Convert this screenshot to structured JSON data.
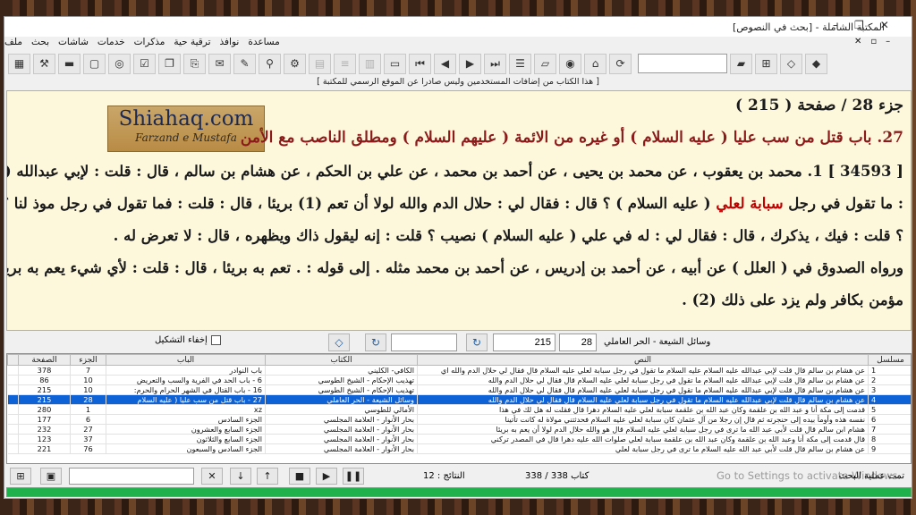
{
  "window": {
    "title": "المكتبة الشاملة - [بحث في النصوص]",
    "controls": [
      "–",
      "❐",
      "✕"
    ]
  },
  "menu": {
    "items": [
      "ملف",
      "بحث",
      "شاشات",
      "خدمات",
      "مذكرات",
      "ترقية حية",
      "نوافذ",
      "مساعدة"
    ],
    "mdi": [
      "–",
      "▫",
      "✕"
    ]
  },
  "toolbar": {
    "search_value": ""
  },
  "notice": "[ هذا الكتاب من إضافات المستخدمين وليس صادرا عن الموقع الرسمي للمكتبة ]",
  "logo": {
    "main": "Shiahaq.com",
    "sub": "Farzand e Mustafa"
  },
  "reader": {
    "page_line": "جزء 28 / صفحة ( 215 )",
    "heading": "27. باب قتل من سب عليا ( عليه السلام ) أو غيره من الائمة ( عليهم السلام ) ومطلق الناصب مع الأمن",
    "line1": "[ 34593 ] 1. محمد بن يعقوب ، عن محمد بن يحيى ، عن أحمد بن محمد ، عن علي بن الحكم ، عن هشام بن سالم ، قال : قلت : لإبي عبدالله ( عليه السلام )",
    "line2_a": ": ما تقول في رجل",
    "line2_red": "سبابة لعلي",
    "line2_b": "( عليه السلام ) ؟ قال : فقال لي : حلال الدم والله لولا أن تعم (1) بريئا ، قال : قلت : فما تقول في رجل موذ لنا ؟ قال : في ماذا",
    "line3": "؟ قلت : فيك ، يذكرك ، قال : فقال لي : له في علي ( عليه السلام ) نصيب ؟ قلت : إنه ليقول ذاك ويظهره ، قال : لا تعرض له .",
    "line4": "ورواه الصدوق في ( العلل ) عن أبيه ، عن أحمد بن إدريس ، عن أحمد بن محمد مثله . إلى قوله : . تعم به بريئا ، قال : قلت : لأي شيء يعم به بريئا ؟ قال : يقتل",
    "line5": "مؤمن بكافر ولم يزد على ذلك (2) ."
  },
  "controls": {
    "hide_diacritics": "إخفاء التشكيل",
    "page_value": "215",
    "part_value": "28",
    "book": "وسائل الشيعة - الحر العاملي",
    "blank1": "",
    "blank2": ""
  },
  "grid": {
    "headers": [
      "",
      "الصفحة",
      "الجزء",
      "الباب",
      "الكتاب",
      "النص",
      "مسلسل"
    ],
    "rows": [
      {
        "page": "378",
        "part": "7",
        "chapter": "باب النوادر",
        "book": "الكافي- الكليني",
        "text": "عن هشام بن سالم قال قلت لإبي عبدالله عليه السلام عليه السلام ما تقول في رجل سبابة لعلي عليه السلام قال فقال لي حلال الدم والله اي",
        "n": "1"
      },
      {
        "page": "86",
        "part": "10",
        "chapter": "6 - باب الحد في الفرية والسب والتعريض",
        "book": "تهذيب الإحكام - الشيخ الطوسي",
        "text": "عن هشام بن سالم قال قلت لإبي عبدالله عليه السلام ما تقول في رجل سبابة لعلي عليه السلام قال فقال لي حلال الدم والله",
        "n": "2"
      },
      {
        "page": "215",
        "part": "10",
        "chapter": "16 - باب القتال في الشهر الحرام والحرم:",
        "book": "تهذيب الإحكام - الشيخ الطوسي",
        "text": "عن هشام بن سالم قال قلت لإبي عبدالله عليه السلام ما تقول في رجل سبابة لعلي عليه السلام قال فقال لي حلال الدم والله",
        "n": "3"
      },
      {
        "page": "215",
        "part": "28",
        "chapter": "27 - باب قتل من سب عليا ( عليه السلام",
        "book": "وسائل الشيعة - الحر العاملي",
        "text": "عن هشام بن سالم قال قلت لإبي عبدالله عليه السلام ما تقول في رجل سبابة لعلي عليه السلام قال فقال لي حلال الدم والله",
        "n": "4"
      },
      {
        "page": "280",
        "part": "1",
        "chapter": "xz",
        "book": "الأمالي للطوسي",
        "text": "قدمت إلى مكة أنا و عبد الله بن علقمة وكان عبد الله بن علقمة سبابة لعلي عليه السلام دهرا قال فقلت له هل لك في هذا",
        "n": "5"
      },
      {
        "page": "177",
        "part": "6",
        "chapter": "الجزء السادس",
        "book": "بحار الأنوار - العلامة المجلسي",
        "text": "نفسه هذه وأومأ بيده إلى حنجرته ثم قال إن رجلا من آل عثمان كان سبابة لعلي عليه السلام فحدثتني مولاة له كانت تأتينا",
        "n": "6"
      },
      {
        "page": "232",
        "part": "27",
        "chapter": "الجزء السابع والعشرون",
        "book": "بحار الأنوار - العلامة المجلسي",
        "text": "هشام ابن سالم قال قلت لأبي عبد الله ما ترى في رجل سبابة لعلي عليه السلام قال هو والله حلال الدم لولا أن يعم به بريئا",
        "n": "7"
      },
      {
        "page": "123",
        "part": "37",
        "chapter": "الجزء السابع والثلاثون",
        "book": "بحار الأنوار - العلامة المجلسي",
        "text": "قال قدمت إلى مكة أنا وعبد الله بن علقمة وكان عبد الله بن علقمة سبابة لعلي صلوات الله عليه دهرا قال في المصدر تركني",
        "n": "8"
      },
      {
        "page": "221",
        "part": "76",
        "chapter": "الجزء السادس والسبعون",
        "book": "بحار الأنوار - العلامة المجلسي",
        "text": "عن هشام بن سالم قال قلت لأبي عبد الله عليه السلام ما ترى في رجل سبابة لعلي",
        "n": "9"
      }
    ]
  },
  "status": {
    "results": "النتائج : 12",
    "book_count": "كتاب 338 / 338",
    "operation": "تمت عملية البحث",
    "watermark": "Go to Settings to activate Windows.",
    "input": ""
  }
}
